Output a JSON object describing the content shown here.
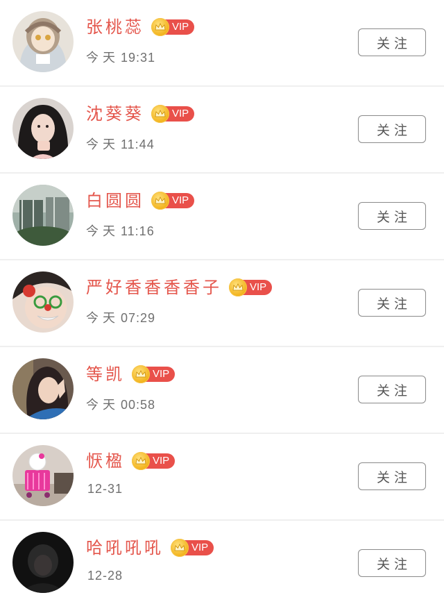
{
  "users": [
    {
      "name": "张桃蕊",
      "name_color": "#e4564c",
      "vip_label": "VIP",
      "day": "今天",
      "time": "19:31",
      "follow_label": "关注"
    },
    {
      "name": "沈葵葵",
      "name_color": "#e4564c",
      "vip_label": "VIP",
      "day": "今天",
      "time": "11:44",
      "follow_label": "关注"
    },
    {
      "name": "白圆圆",
      "name_color": "#e4564c",
      "vip_label": "VIP",
      "day": "今天",
      "time": "11:16",
      "follow_label": "关注"
    },
    {
      "name": "严好香香香香子",
      "name_color": "#e4564c",
      "vip_label": "VIP",
      "day": "今天",
      "time": "07:29",
      "follow_label": "关注"
    },
    {
      "name": "等凯",
      "name_color": "#e4564c",
      "vip_label": "VIP",
      "day": "今天",
      "time": "00:58",
      "follow_label": "关注"
    },
    {
      "name": "恹楹",
      "name_color": "#e4564c",
      "vip_label": "VIP",
      "day": "",
      "time": "12-31",
      "follow_label": "关注"
    },
    {
      "name": "哈吼吼吼",
      "name_color": "#e4564c",
      "vip_label": "VIP",
      "day": "",
      "time": "12-28",
      "follow_label": "关注"
    }
  ],
  "colors": {
    "vip_badge": "#e9504a",
    "crown": "#f2b21b",
    "divider": "#efefef",
    "follow_border": "#8a8a8a"
  },
  "icons": {
    "vip_badge": "crown-icon"
  }
}
